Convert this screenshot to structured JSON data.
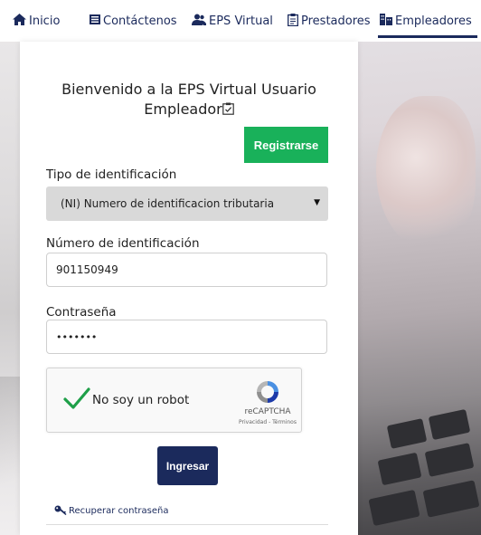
{
  "nav": {
    "items": [
      {
        "label": "Inicio",
        "icon": "home-icon"
      },
      {
        "label": "Contáctenos",
        "icon": "list-icon"
      },
      {
        "label": "EPS Virtual",
        "icon": "users-icon"
      },
      {
        "label": "Prestadores",
        "icon": "clipboard-icon"
      },
      {
        "label": "Empleadores",
        "icon": "building-icon",
        "active": true
      }
    ]
  },
  "login": {
    "welcome_line1": "Bienvenido a la EPS Virtual Usuario",
    "welcome_line2": "Empleador",
    "register_label": "Registrarse",
    "id_type_label": "Tipo de identificación",
    "id_type_value": "(NI) Numero de identificacion tributaria",
    "id_number_label": "Número de identificación",
    "id_number_value": "901150949",
    "password_label": "Contraseña",
    "password_value": "•••••••",
    "submit_label": "Ingresar",
    "recover_label": "Recuperar contraseña"
  },
  "captcha": {
    "checkbox_label": "No soy un robot",
    "brand": "reCAPTCHA",
    "links": "Privacidad - Términos",
    "checked": true
  },
  "colors": {
    "primary": "#1b2a5c",
    "success": "#19b15a",
    "select_bg": "#d9d9d9"
  }
}
